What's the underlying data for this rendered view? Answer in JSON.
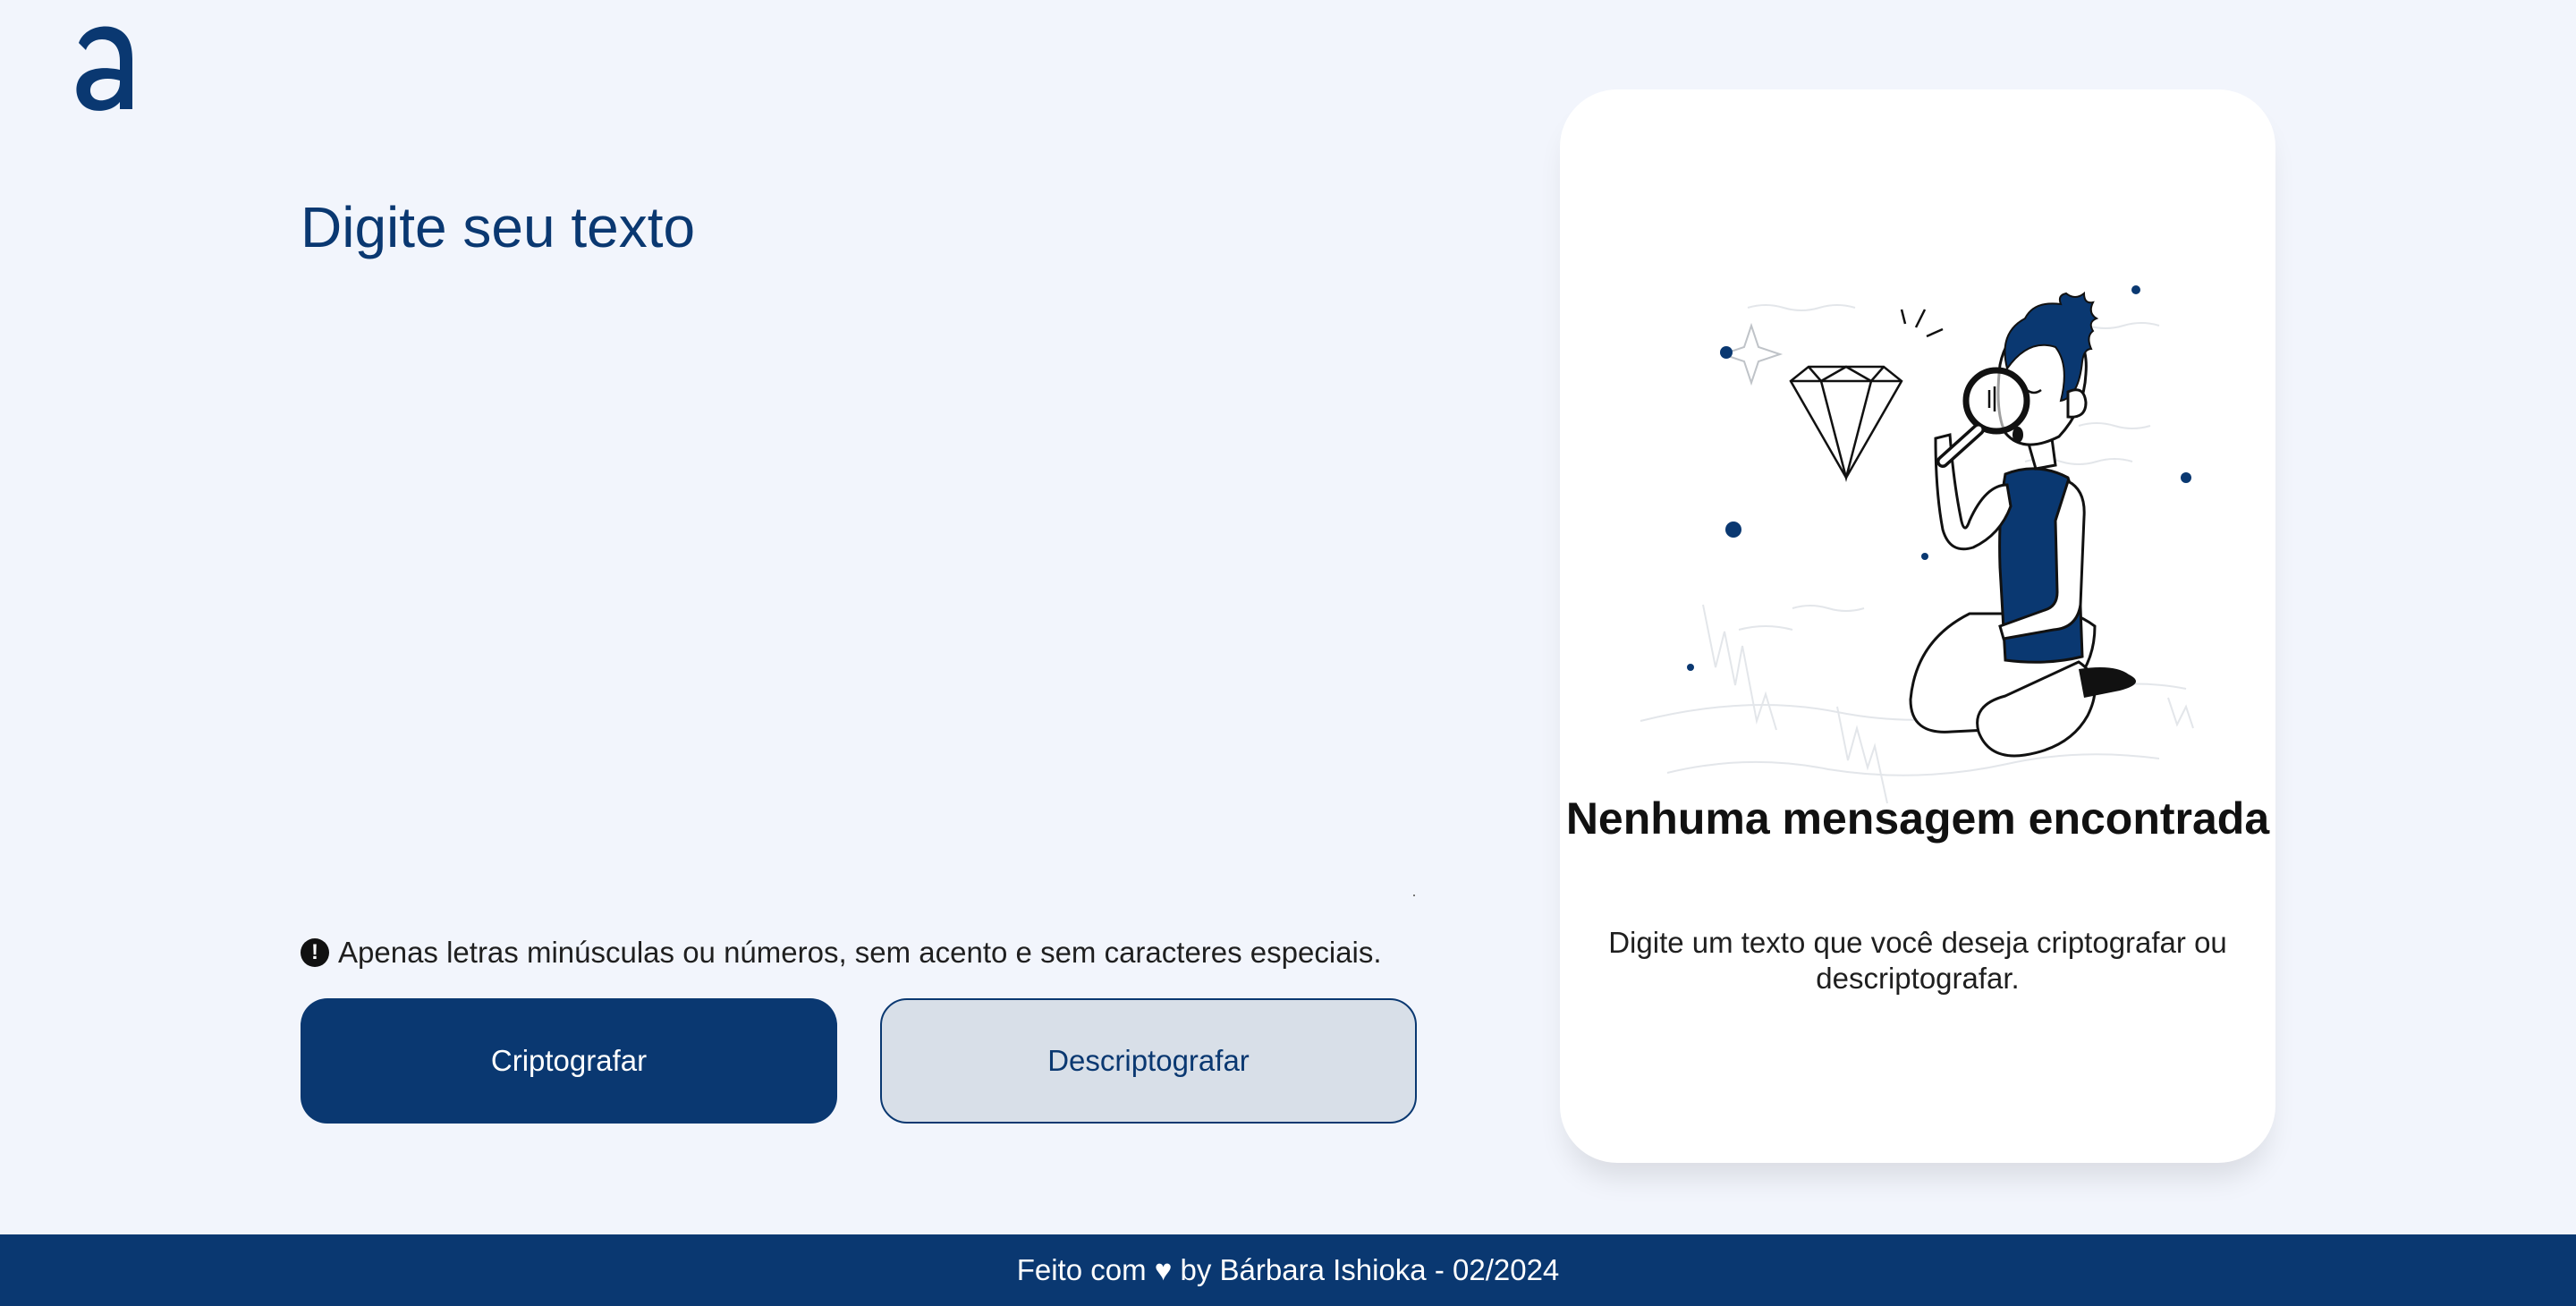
{
  "header": {
    "logo": "alura-logo-icon"
  },
  "editor": {
    "placeholder": "Digite seu texto"
  },
  "hint": {
    "icon": "exclamation-circle-icon",
    "text": "Apenas letras minúsculas ou números, sem acento e sem caracteres especiais."
  },
  "buttons": {
    "encrypt_label": "Criptografar",
    "decrypt_label": "Descriptografar"
  },
  "result_card": {
    "illustration": "person-with-magnifying-glass-icon",
    "title": "Nenhuma mensagem encontrada",
    "text": "Digite um texto que você deseja criptografar ou descriptografar."
  },
  "footer": {
    "text": "Feito com ♥ by Bárbara Ishioka - 02/2024"
  },
  "colors": {
    "background": "#f2f5fc",
    "primary": "#0a3871",
    "secondary_button_bg": "#d8dfe8",
    "card_bg": "#ffffff"
  }
}
